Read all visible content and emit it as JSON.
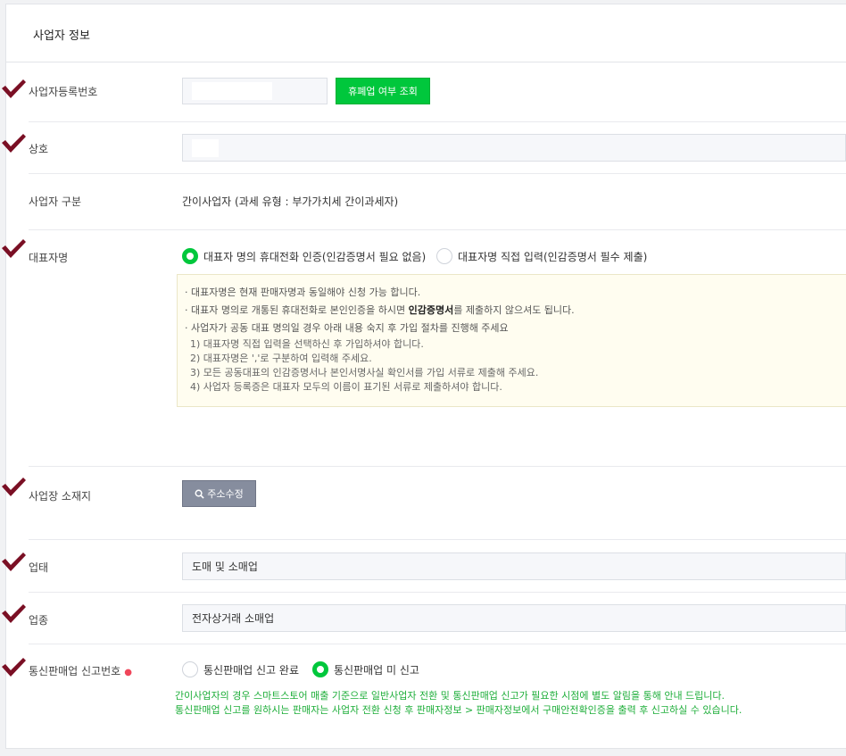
{
  "section": {
    "title": "사업자 정보"
  },
  "business_reg": {
    "label": "사업자등록번호",
    "check_button": "휴폐업 여부 조회"
  },
  "trade_name": {
    "label": "상호"
  },
  "business_type": {
    "label": "사업자 구분",
    "value": "간이사업자 (과세 유형 : 부가가치세 간이과세자)"
  },
  "representative": {
    "label": "대표자명",
    "options": [
      {
        "label": "대표자 명의 휴대전화 인증(인감증명서 필요 없음)",
        "selected": true
      },
      {
        "label": "대표자명 직접 입력(인감증명서 필수 제출)",
        "selected": false
      }
    ],
    "notice": {
      "line1": "· 대표자명은 현재 판매자명과 동일해야 신청 가능 합니다.",
      "line2_pre": "· 대표자 명의로 개통된 휴대전화로 본인인증을 하시면 ",
      "line2_bold": "인감증명서",
      "line2_post": "를 제출하지 않으셔도 됩니다.",
      "line3": "· 사업자가 공동 대표 명의일 경우 아래 내용 숙지 후 가입 절차를 진행해 주세요",
      "sub1": "1) 대표자명 직접 입력을 선택하신 후 가입하셔야 합니다.",
      "sub2": "2) 대표자명은 ','로 구분하여 입력해 주세요.",
      "sub3": "3) 모든 공동대표의 인감증명서나 본인서명사실 확인서를 가입 서류로 제출해 주세요.",
      "sub4": "4) 사업자 등록증은 대표자 모두의 이름이 표기된 서류로 제출하셔야 합니다."
    }
  },
  "address": {
    "label": "사업장 소재지",
    "edit_button": "주소수정",
    "icon": "search-icon"
  },
  "category": {
    "label": "업태",
    "value": "도매 및 소매업"
  },
  "item": {
    "label": "업종",
    "value": "전자상거래 소매업"
  },
  "ecommerce": {
    "label": "통신판매업 신고번호",
    "required_mark": "●",
    "options": [
      {
        "label": "통신판매업 신고 완료",
        "selected": false
      },
      {
        "label": "통신판매업 미 신고",
        "selected": true
      }
    ],
    "note1": "간이사업자의 경우 스마트스토어 매출 기준으로 일반사업자 전환 및 통신판매업 신고가 필요한 시점에 별도 알림을 통해 안내 드립니다.",
    "note2": "통신판매업 신고를 원하시는 판매자는 사업자 전환 신청 후 판매자정보 > 판매자정보에서 구매안전확인증을 출력 후 신고하실 수 있습니다."
  },
  "colors": {
    "accent_green": "#00c73c",
    "check_mark": "#7a0f24",
    "gray_button": "#868d9e"
  }
}
